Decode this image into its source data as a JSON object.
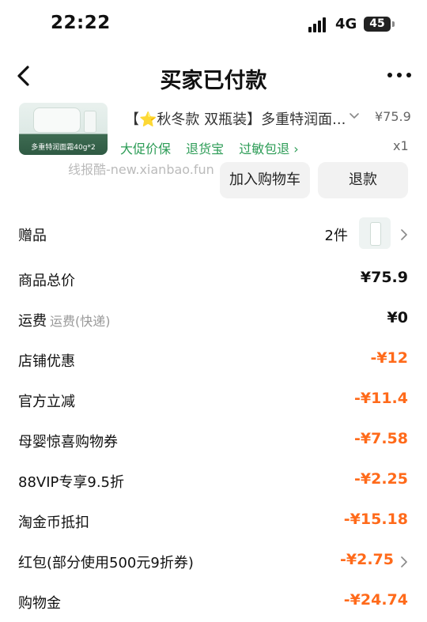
{
  "status_bar": {
    "time": "22:22",
    "network": "4G",
    "battery": "45"
  },
  "nav": {
    "title": "买家已付款",
    "back_icon": "chevron-left-icon",
    "more_icon": "more-dots-icon"
  },
  "product": {
    "thumbnail_caption": "多重特润面霜40g*2",
    "title": "【⭐秋冬款 双瓶装】多重特润面...",
    "price": "¥75.9",
    "tags": [
      "大促价保",
      "退货宝",
      "过敏包退 ›"
    ],
    "quantity": "x1"
  },
  "watermark": "线报酷-new.xianbao.fun",
  "actions": {
    "add_to_cart": "加入购物车",
    "refund": "退款"
  },
  "gift": {
    "label": "赠品",
    "count": "2件"
  },
  "summary": [
    {
      "label": "商品总价",
      "sub": "",
      "value": "¥75.9"
    },
    {
      "label": "运费",
      "sub": "运费(快递)",
      "value": "¥0"
    },
    {
      "label": "店铺优惠",
      "sub": "",
      "value": "-¥12"
    },
    {
      "label": "官方立减",
      "sub": "",
      "value": "-¥11.4"
    },
    {
      "label": "母婴惊喜购物券",
      "sub": "",
      "value": "-¥7.58"
    },
    {
      "label": "88VIP专享9.5折",
      "sub": "",
      "value": "-¥2.25"
    },
    {
      "label": "淘金币抵扣",
      "sub": "",
      "value": "-¥15.18"
    },
    {
      "label": "红包(部分使用500元9折券)",
      "sub": "",
      "value": "-¥2.75"
    },
    {
      "label": "购物金",
      "sub": "",
      "value": "-¥24.74"
    }
  ],
  "colors": {
    "discount": "#ff6a1a",
    "promo": "#2c9c56"
  }
}
